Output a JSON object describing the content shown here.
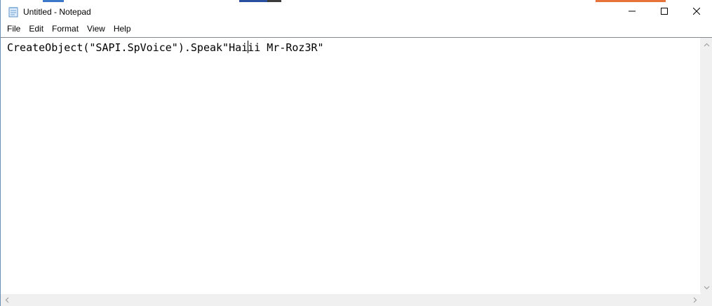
{
  "window": {
    "title": "Untitled - Notepad",
    "accent": "#6d8fb4"
  },
  "icons": {
    "app": "notepad-icon",
    "minimize": "minimize-icon",
    "maximize": "maximize-icon",
    "close": "close-icon",
    "scroll_up": "chevron-up-icon",
    "scroll_down": "chevron-down-icon",
    "scroll_left": "chevron-left-icon",
    "scroll_right": "chevron-right-icon"
  },
  "menu": {
    "items": [
      {
        "label": "File"
      },
      {
        "label": "Edit"
      },
      {
        "label": "Format"
      },
      {
        "label": "View"
      },
      {
        "label": "Help"
      }
    ]
  },
  "editor": {
    "text_before_caret": "CreateObject(\"SAPI.SpVoice\").Speak\"Hai",
    "text_after_caret": "ii Mr-Roz3R\""
  }
}
